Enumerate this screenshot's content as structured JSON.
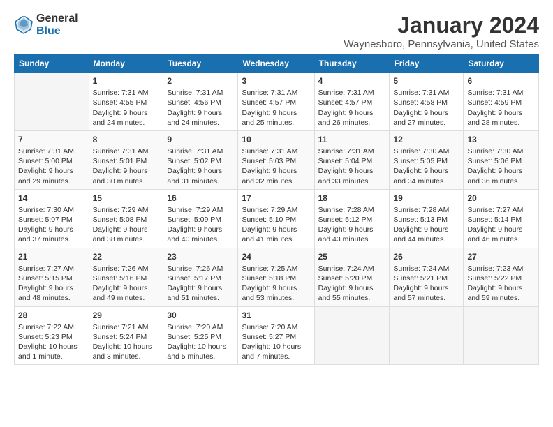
{
  "header": {
    "logo_general": "General",
    "logo_blue": "Blue",
    "title": "January 2024",
    "subtitle": "Waynesboro, Pennsylvania, United States"
  },
  "days_of_week": [
    "Sunday",
    "Monday",
    "Tuesday",
    "Wednesday",
    "Thursday",
    "Friday",
    "Saturday"
  ],
  "weeks": [
    [
      {
        "num": "",
        "info": ""
      },
      {
        "num": "1",
        "info": "Sunrise: 7:31 AM\nSunset: 4:55 PM\nDaylight: 9 hours\nand 24 minutes."
      },
      {
        "num": "2",
        "info": "Sunrise: 7:31 AM\nSunset: 4:56 PM\nDaylight: 9 hours\nand 24 minutes."
      },
      {
        "num": "3",
        "info": "Sunrise: 7:31 AM\nSunset: 4:57 PM\nDaylight: 9 hours\nand 25 minutes."
      },
      {
        "num": "4",
        "info": "Sunrise: 7:31 AM\nSunset: 4:57 PM\nDaylight: 9 hours\nand 26 minutes."
      },
      {
        "num": "5",
        "info": "Sunrise: 7:31 AM\nSunset: 4:58 PM\nDaylight: 9 hours\nand 27 minutes."
      },
      {
        "num": "6",
        "info": "Sunrise: 7:31 AM\nSunset: 4:59 PM\nDaylight: 9 hours\nand 28 minutes."
      }
    ],
    [
      {
        "num": "7",
        "info": "Sunrise: 7:31 AM\nSunset: 5:00 PM\nDaylight: 9 hours\nand 29 minutes."
      },
      {
        "num": "8",
        "info": "Sunrise: 7:31 AM\nSunset: 5:01 PM\nDaylight: 9 hours\nand 30 minutes."
      },
      {
        "num": "9",
        "info": "Sunrise: 7:31 AM\nSunset: 5:02 PM\nDaylight: 9 hours\nand 31 minutes."
      },
      {
        "num": "10",
        "info": "Sunrise: 7:31 AM\nSunset: 5:03 PM\nDaylight: 9 hours\nand 32 minutes."
      },
      {
        "num": "11",
        "info": "Sunrise: 7:31 AM\nSunset: 5:04 PM\nDaylight: 9 hours\nand 33 minutes."
      },
      {
        "num": "12",
        "info": "Sunrise: 7:30 AM\nSunset: 5:05 PM\nDaylight: 9 hours\nand 34 minutes."
      },
      {
        "num": "13",
        "info": "Sunrise: 7:30 AM\nSunset: 5:06 PM\nDaylight: 9 hours\nand 36 minutes."
      }
    ],
    [
      {
        "num": "14",
        "info": "Sunrise: 7:30 AM\nSunset: 5:07 PM\nDaylight: 9 hours\nand 37 minutes."
      },
      {
        "num": "15",
        "info": "Sunrise: 7:29 AM\nSunset: 5:08 PM\nDaylight: 9 hours\nand 38 minutes."
      },
      {
        "num": "16",
        "info": "Sunrise: 7:29 AM\nSunset: 5:09 PM\nDaylight: 9 hours\nand 40 minutes."
      },
      {
        "num": "17",
        "info": "Sunrise: 7:29 AM\nSunset: 5:10 PM\nDaylight: 9 hours\nand 41 minutes."
      },
      {
        "num": "18",
        "info": "Sunrise: 7:28 AM\nSunset: 5:12 PM\nDaylight: 9 hours\nand 43 minutes."
      },
      {
        "num": "19",
        "info": "Sunrise: 7:28 AM\nSunset: 5:13 PM\nDaylight: 9 hours\nand 44 minutes."
      },
      {
        "num": "20",
        "info": "Sunrise: 7:27 AM\nSunset: 5:14 PM\nDaylight: 9 hours\nand 46 minutes."
      }
    ],
    [
      {
        "num": "21",
        "info": "Sunrise: 7:27 AM\nSunset: 5:15 PM\nDaylight: 9 hours\nand 48 minutes."
      },
      {
        "num": "22",
        "info": "Sunrise: 7:26 AM\nSunset: 5:16 PM\nDaylight: 9 hours\nand 49 minutes."
      },
      {
        "num": "23",
        "info": "Sunrise: 7:26 AM\nSunset: 5:17 PM\nDaylight: 9 hours\nand 51 minutes."
      },
      {
        "num": "24",
        "info": "Sunrise: 7:25 AM\nSunset: 5:18 PM\nDaylight: 9 hours\nand 53 minutes."
      },
      {
        "num": "25",
        "info": "Sunrise: 7:24 AM\nSunset: 5:20 PM\nDaylight: 9 hours\nand 55 minutes."
      },
      {
        "num": "26",
        "info": "Sunrise: 7:24 AM\nSunset: 5:21 PM\nDaylight: 9 hours\nand 57 minutes."
      },
      {
        "num": "27",
        "info": "Sunrise: 7:23 AM\nSunset: 5:22 PM\nDaylight: 9 hours\nand 59 minutes."
      }
    ],
    [
      {
        "num": "28",
        "info": "Sunrise: 7:22 AM\nSunset: 5:23 PM\nDaylight: 10 hours\nand 1 minute."
      },
      {
        "num": "29",
        "info": "Sunrise: 7:21 AM\nSunset: 5:24 PM\nDaylight: 10 hours\nand 3 minutes."
      },
      {
        "num": "30",
        "info": "Sunrise: 7:20 AM\nSunset: 5:25 PM\nDaylight: 10 hours\nand 5 minutes."
      },
      {
        "num": "31",
        "info": "Sunrise: 7:20 AM\nSunset: 5:27 PM\nDaylight: 10 hours\nand 7 minutes."
      },
      {
        "num": "",
        "info": ""
      },
      {
        "num": "",
        "info": ""
      },
      {
        "num": "",
        "info": ""
      }
    ]
  ]
}
